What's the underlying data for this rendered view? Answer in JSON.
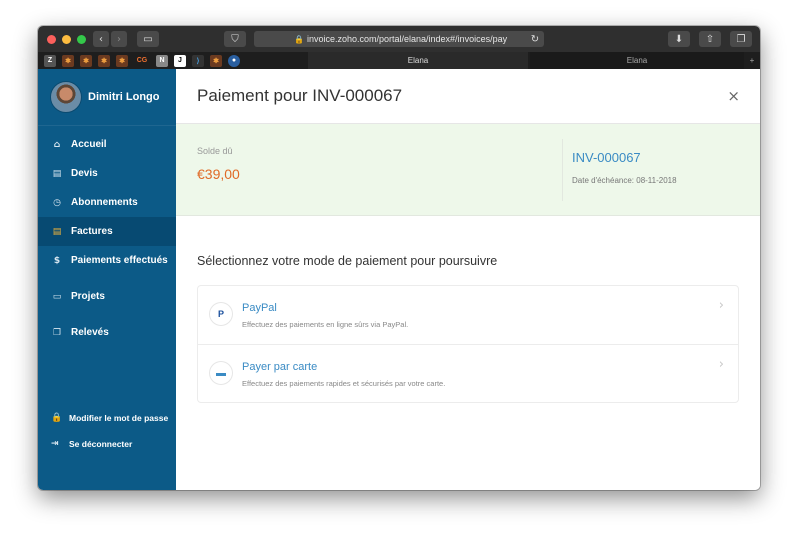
{
  "browser": {
    "url": "invoice.zoho.com/portal/elana/index#/invoices/pay",
    "tabs": [
      "Elana",
      "Elana"
    ],
    "back_icon": "chevron-left-icon",
    "forward_icon": "chevron-right-icon",
    "favicons": [
      "Z",
      "✱",
      "✱",
      "✱",
      "✱",
      "CG",
      "N",
      "J",
      "⟩",
      "✱",
      "●"
    ]
  },
  "sidebar": {
    "user_name": "Dimitri Longo",
    "items": [
      {
        "label": "Accueil",
        "icon": "⌂"
      },
      {
        "label": "Devis",
        "icon": "▤"
      },
      {
        "label": "Abonnements",
        "icon": "◷"
      },
      {
        "label": "Factures",
        "icon": "▤"
      },
      {
        "label": "Paiements effectués",
        "icon": "$"
      },
      {
        "label": "Projets",
        "icon": "▭"
      },
      {
        "label": "Relevés",
        "icon": "❐"
      }
    ],
    "change_password": "Modifier le mot de passe",
    "logout": "Se déconnecter"
  },
  "modal": {
    "title": "Paiement pour INV-000067",
    "close": "×",
    "balance_label": "Solde dû",
    "balance_amount": "€39,00",
    "invoice_number": "INV-000067",
    "due_date": "Date d'échéance: 08-11-2018",
    "select_title": "Sélectionnez votre mode de paiement pour poursuivre",
    "methods": [
      {
        "name": "PayPal",
        "description": "Effectuez des paiements en ligne sûrs via PayPal.",
        "icon": "P"
      },
      {
        "name": "Payer par carte",
        "description": "Effectuez des paiements rapides et sécurisés par votre carte.",
        "icon": "▬"
      }
    ]
  },
  "colors": {
    "sidebar": "#0c5a87",
    "sidebar_active": "#074a72",
    "accent_blue": "#3a8bc4",
    "amount_orange": "#e06a26",
    "balance_bg": "#eef8ea"
  }
}
